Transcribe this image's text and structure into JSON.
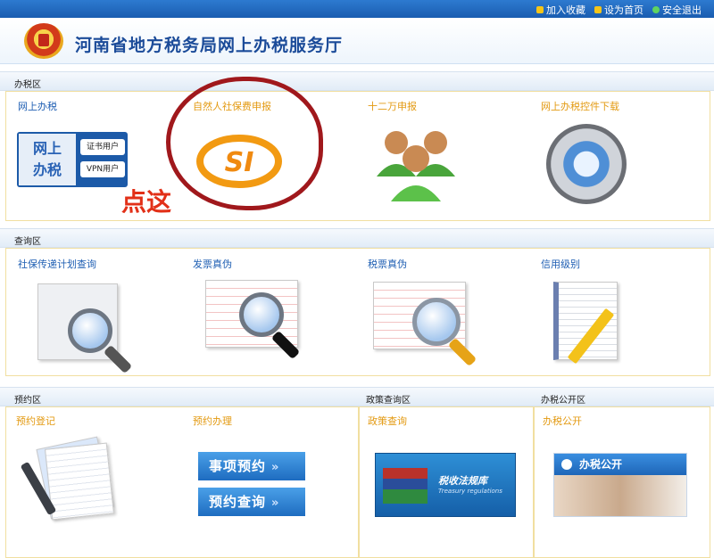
{
  "topbar": {
    "links": [
      "加入收藏",
      "设为首页",
      "安全退出"
    ],
    "colors": [
      "#f5c518",
      "#f5c518",
      "#5fd35f"
    ]
  },
  "header": {
    "title": "河南省地方税务局网上办税服务厅"
  },
  "sections": {
    "office": {
      "label": "办税区",
      "items": [
        "网上办税",
        "自然人社保费申报",
        "十二万申报",
        "网上办税控件下载"
      ]
    },
    "query": {
      "label": "查询区",
      "items": [
        "社保传递计划查询",
        "发票真伪",
        "税票真伪",
        "信用级别"
      ]
    },
    "booking": {
      "label": "预约区",
      "items": [
        "预约登记",
        "预约办理"
      ]
    },
    "policy": {
      "label": "政策查询区",
      "items": [
        "政策查询"
      ]
    },
    "public": {
      "label": "办税公开区",
      "items": [
        "办税公开"
      ]
    }
  },
  "online_tax_logo": {
    "main": "网上\n办税",
    "btn1": "证书用户",
    "btn2": "VPN用户"
  },
  "si_logo": "SI",
  "annotation": "点这",
  "booking_buttons": {
    "item_booking": "事项预约",
    "booking_query": "预约查询",
    "arrow": "»"
  },
  "policy_banner": {
    "text": "税收法规库",
    "sub": "Treasury regulations"
  },
  "public_banner": {
    "text": "办税公开"
  },
  "brand_colors": {
    "title": "#1b4b99",
    "link": "#1f5fb3",
    "orange": "#e39a12",
    "annotation": "#e23018",
    "circle": "#a0181c"
  }
}
